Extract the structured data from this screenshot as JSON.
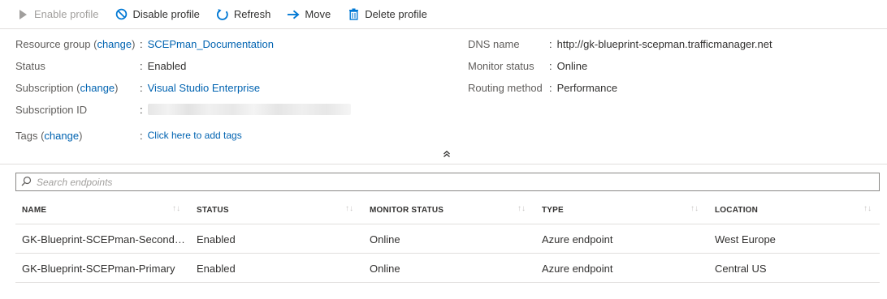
{
  "toolbar": {
    "enable_label": "Enable profile",
    "disable_label": "Disable profile",
    "refresh_label": "Refresh",
    "move_label": "Move",
    "delete_label": "Delete profile"
  },
  "essentials": {
    "resource_group": {
      "label": "Resource group",
      "change": "change",
      "value": "SCEPman_Documentation"
    },
    "status": {
      "label": "Status",
      "value": "Enabled"
    },
    "subscription": {
      "label": "Subscription",
      "change": "change",
      "value": "Visual Studio Enterprise"
    },
    "subscription_id": {
      "label": "Subscription ID",
      "value": ""
    },
    "tags": {
      "label": "Tags",
      "change": "change",
      "value": "Click here to add tags"
    },
    "dns_name": {
      "label": "DNS name",
      "value": "http://gk-blueprint-scepman.trafficmanager.net"
    },
    "monitor_status": {
      "label": "Monitor status",
      "value": "Online"
    },
    "routing_method": {
      "label": "Routing method",
      "value": "Performance"
    }
  },
  "search": {
    "placeholder": "Search endpoints",
    "value": ""
  },
  "table": {
    "columns": [
      "NAME",
      "STATUS",
      "MONITOR STATUS",
      "TYPE",
      "LOCATION"
    ],
    "rows": [
      {
        "name": "GK-Blueprint-SCEPman-Seconda...",
        "status": "Enabled",
        "monitor_status": "Online",
        "type": "Azure endpoint",
        "location": "West Europe"
      },
      {
        "name": "GK-Blueprint-SCEPman-Primary",
        "status": "Enabled",
        "monitor_status": "Online",
        "type": "Azure endpoint",
        "location": "Central US"
      }
    ]
  },
  "colors": {
    "link": "#0063b1",
    "accent_icon": "#0078d4",
    "border": "#e1dfdd"
  },
  "icons": [
    "play-icon",
    "disable-icon",
    "refresh-icon",
    "move-arrow-icon",
    "trash-icon",
    "search-icon",
    "collapse-chevron-icon",
    "sort-icon"
  ]
}
